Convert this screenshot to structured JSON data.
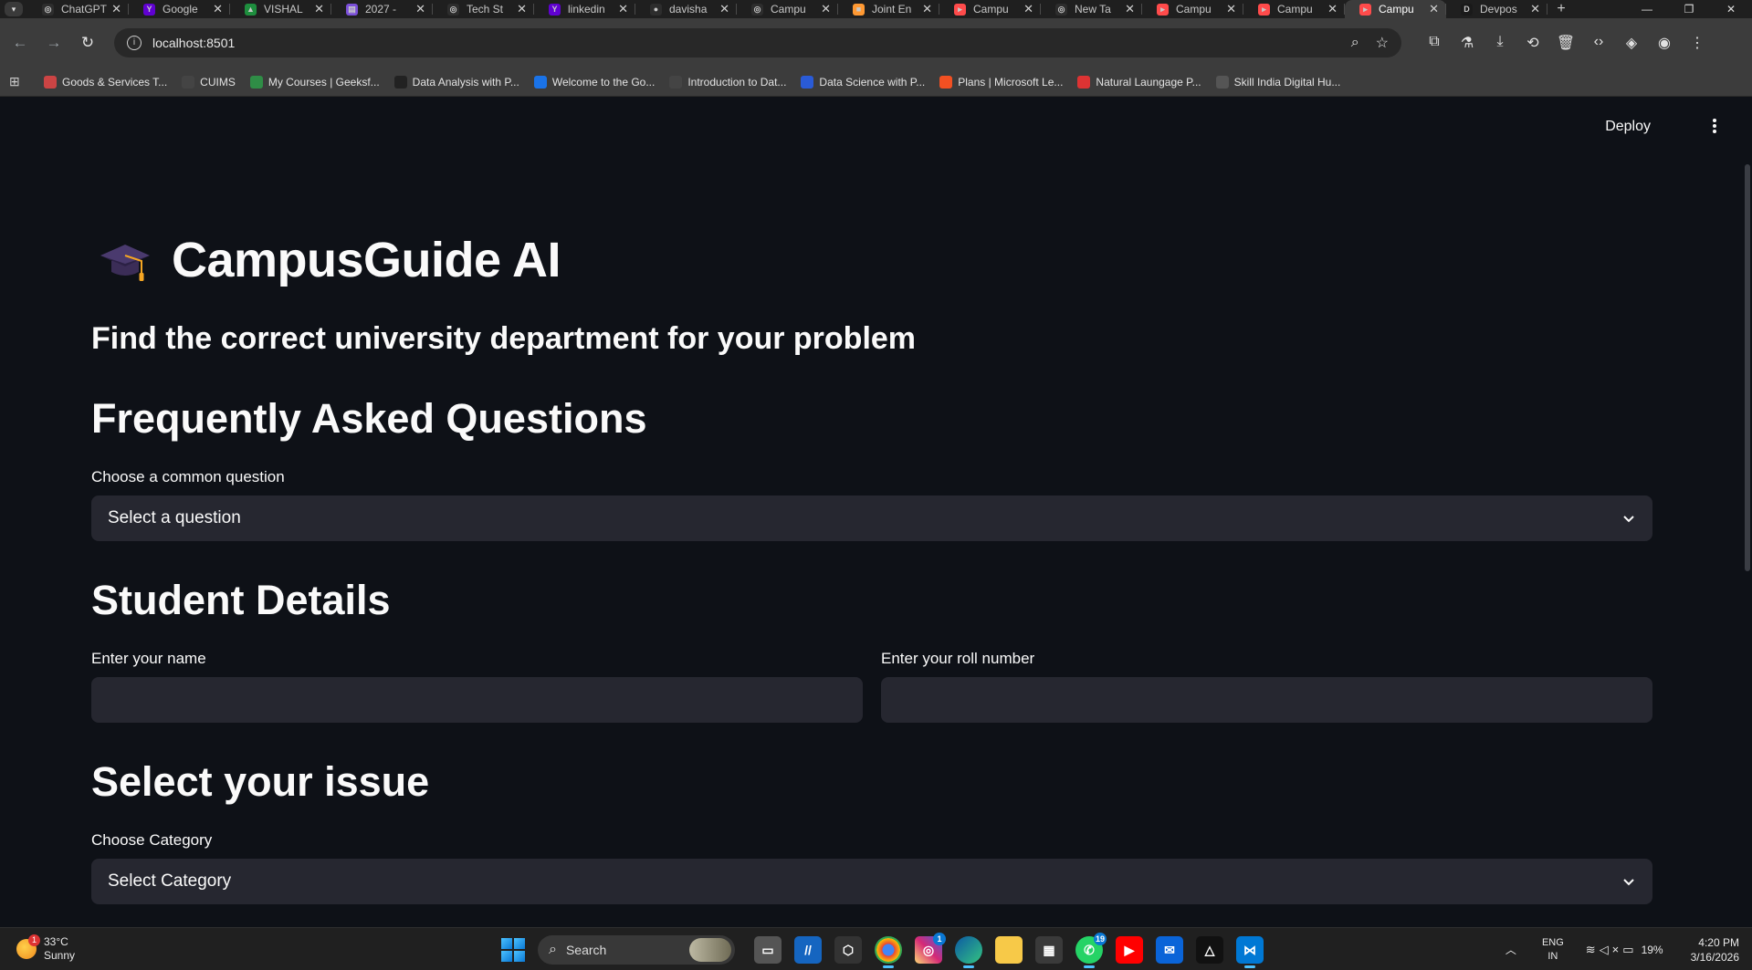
{
  "browser": {
    "tabs": [
      {
        "title": "ChatGPT",
        "fav_color": "#2d2d2d",
        "fav_char": "◎"
      },
      {
        "title": "Google",
        "fav_color": "#6001d2",
        "fav_char": "Y"
      },
      {
        "title": "VISHAL",
        "fav_color": "#1e8e3e",
        "fav_char": "▲"
      },
      {
        "title": "2027 -",
        "fav_color": "#7b4fd8",
        "fav_char": "▤"
      },
      {
        "title": "Tech St",
        "fav_color": "#2d2d2d",
        "fav_char": "◎"
      },
      {
        "title": "linkedin",
        "fav_color": "#6001d2",
        "fav_char": "Y"
      },
      {
        "title": "davisha",
        "fav_color": "#2d2d2d",
        "fav_char": "●"
      },
      {
        "title": "Campu",
        "fav_color": "#2d2d2d",
        "fav_char": "◎"
      },
      {
        "title": "Joint En",
        "fav_color": "#ff9933",
        "fav_char": "■"
      },
      {
        "title": "Campu",
        "fav_color": "#ff4b4b",
        "fav_char": "▸"
      },
      {
        "title": "New Ta",
        "fav_color": "#2d2d2d",
        "fav_char": "◎"
      },
      {
        "title": "Campu",
        "fav_color": "#ff4b4b",
        "fav_char": "▸"
      },
      {
        "title": "Campu",
        "fav_color": "#ff4b4b",
        "fav_char": "▸"
      },
      {
        "title": "Campu",
        "fav_color": "#ff4b4b",
        "fav_char": "▸",
        "active": true
      },
      {
        "title": "Devpos",
        "fav_color": "#1a1a1a",
        "fav_char": "D"
      }
    ],
    "url": "localhost:8501",
    "bookmarks": [
      {
        "label": "Goods & Services T...",
        "color": "#c44"
      },
      {
        "label": "CUIMS",
        "color": "#444"
      },
      {
        "label": "My Courses | Geeksf...",
        "color": "#2f8d46"
      },
      {
        "label": "Data Analysis with P...",
        "color": "#222"
      },
      {
        "label": "Welcome to the Go...",
        "color": "#1a73e8"
      },
      {
        "label": "Introduction to Dat...",
        "color": "#444"
      },
      {
        "label": "Data Science with P...",
        "color": "#2a5bd7"
      },
      {
        "label": "Plans | Microsoft Le...",
        "color": "#f25022"
      },
      {
        "label": "Natural Laungage P...",
        "color": "#d33"
      },
      {
        "label": "Skill India Digital Hu...",
        "color": "#555"
      }
    ]
  },
  "app": {
    "deploy_label": "Deploy",
    "title": "CampusGuide AI",
    "subtitle": "Find the correct university department for your problem",
    "faq": {
      "heading": "Frequently Asked Questions",
      "label": "Choose a common question",
      "value": "Select a question"
    },
    "student": {
      "heading": "Student Details",
      "name_label": "Enter your name",
      "name_value": "",
      "roll_label": "Enter your roll number",
      "roll_value": ""
    },
    "issue": {
      "heading": "Select your issue",
      "category_label": "Choose Category",
      "category_value": "Select Category"
    }
  },
  "taskbar": {
    "weather_temp": "33°C",
    "weather_desc": "Sunny",
    "weather_badge": "1",
    "search_label": "Search",
    "instagram_badge": "1",
    "whatsapp_badge": "19",
    "lang_line1": "ENG",
    "lang_line2": "IN",
    "battery": "19%",
    "time": "4:20 PM",
    "date": "3/16/2026"
  }
}
